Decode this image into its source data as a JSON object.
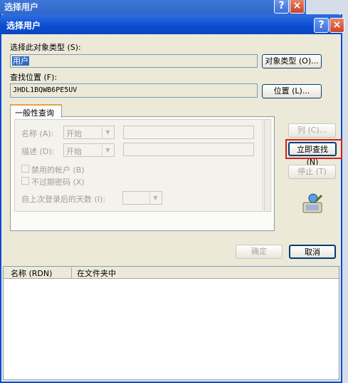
{
  "background_window": {
    "title": "选择用户",
    "help_glyph": "?",
    "close_glyph": "×"
  },
  "dialog": {
    "title": "选择用户",
    "help_glyph": "?",
    "close_glyph": "×"
  },
  "object_type": {
    "label": "选择此对象类型 (S):",
    "value": "用户",
    "button": "对象类型 (O)..."
  },
  "location": {
    "label": "查找位置 (F):",
    "value": "JHDL1BQWB6PE5UV",
    "button": "位置 (L)..."
  },
  "tab": {
    "label": "一般性查询"
  },
  "query": {
    "name_label": "名称 (A):",
    "name_mode": "开始",
    "desc_label": "描述 (D):",
    "desc_mode": "开始",
    "disabled_accounts": "禁用的帐户 (B)",
    "non_expiring": "不过期密码 (X)",
    "days_label": "自上次登录后的天数 (I):"
  },
  "side_buttons": {
    "columns": "列 (C)...",
    "find_now": "立即查找 (N)",
    "stop": "停止 (T)"
  },
  "actions": {
    "ok": "确定",
    "cancel": "取消"
  },
  "results": {
    "columns": [
      "名称 (RDN)",
      "在文件夹中"
    ]
  },
  "icons": {
    "search": "search-users-icon"
  },
  "colors": {
    "titlebar": "#0a4cd0",
    "highlight_border": "#d42020",
    "dialog_bg": "#ece9d8"
  }
}
